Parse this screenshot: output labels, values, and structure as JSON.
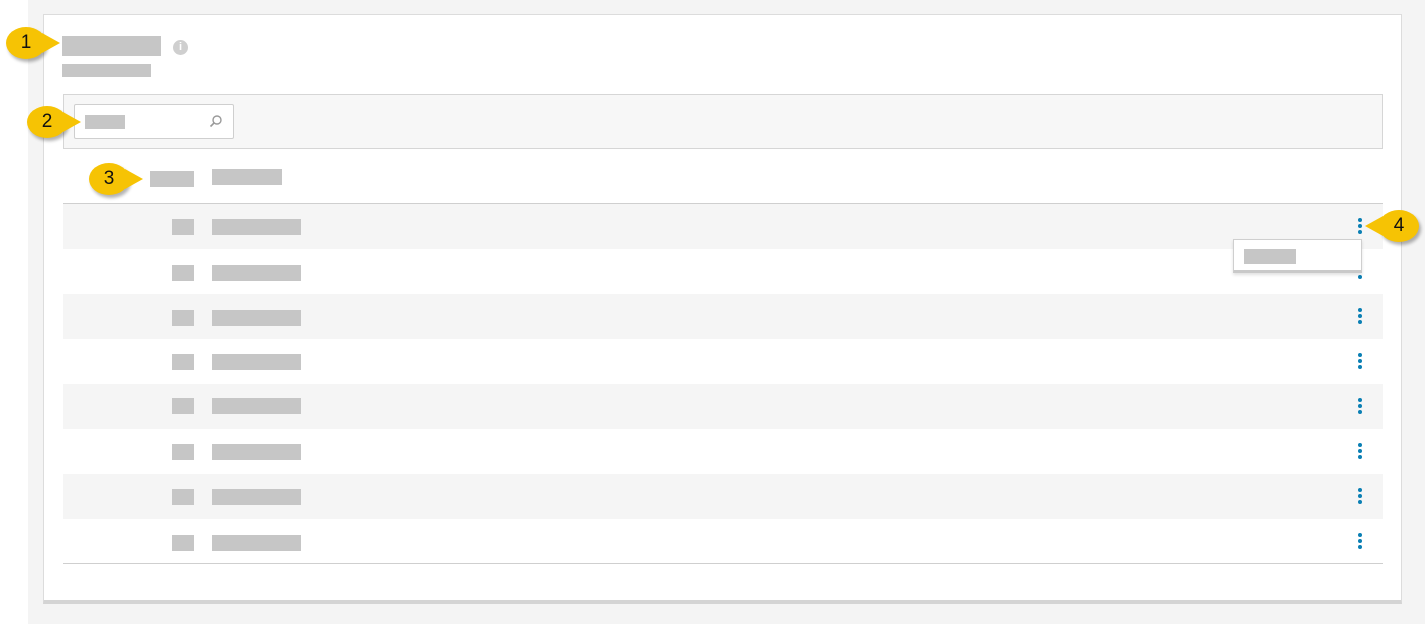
{
  "callouts": [
    "1",
    "2",
    "3",
    "4"
  ],
  "header": {
    "info_icon": "info-icon",
    "info_glyph": "i"
  },
  "search": {
    "icon": "search-icon"
  },
  "table": {
    "row_count": 8,
    "row_action_icon": "kebab-menu-icon"
  },
  "colors": {
    "accent": "#0a7fb4",
    "callout": "#f6c304",
    "placeholder_text": "#c6c6c6"
  }
}
